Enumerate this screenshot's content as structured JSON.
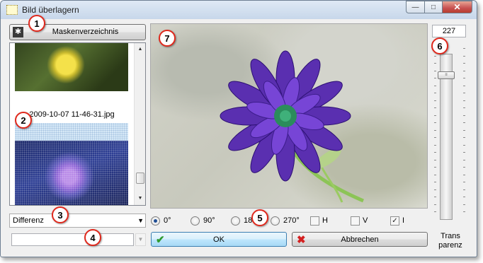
{
  "window": {
    "title": "Bild überlagern",
    "controls": {
      "minimize": "—",
      "maximize": "□",
      "close": "✕"
    }
  },
  "mask_button": {
    "icon": "gear-icon",
    "label": "Maskenverzeichnis"
  },
  "file_list": {
    "selected_file": "2009-10-07 11-46-31.jpg"
  },
  "blend_mode": {
    "selected": "Differenz"
  },
  "mask_input": {
    "value": ""
  },
  "rotation": {
    "options": [
      {
        "label": "0°",
        "selected": true
      },
      {
        "label": "90°",
        "selected": false
      },
      {
        "label": "180°",
        "selected": false
      },
      {
        "label": "270°",
        "selected": false
      }
    ],
    "checkboxes": [
      {
        "label": "H",
        "checked": false
      },
      {
        "label": "V",
        "checked": false
      },
      {
        "label": "I",
        "checked": true
      }
    ]
  },
  "buttons": {
    "ok": "OK",
    "cancel": "Abbrechen"
  },
  "transparency": {
    "value": "227",
    "level": 0.89,
    "label_line1": "Trans",
    "label_line2": "parenz"
  },
  "callouts": [
    "1",
    "2",
    "3",
    "4",
    "5",
    "6",
    "7"
  ],
  "colors": {
    "callout": "#e0281c",
    "ok_icon": "#2f9a2f",
    "cancel_icon": "#d32020"
  }
}
